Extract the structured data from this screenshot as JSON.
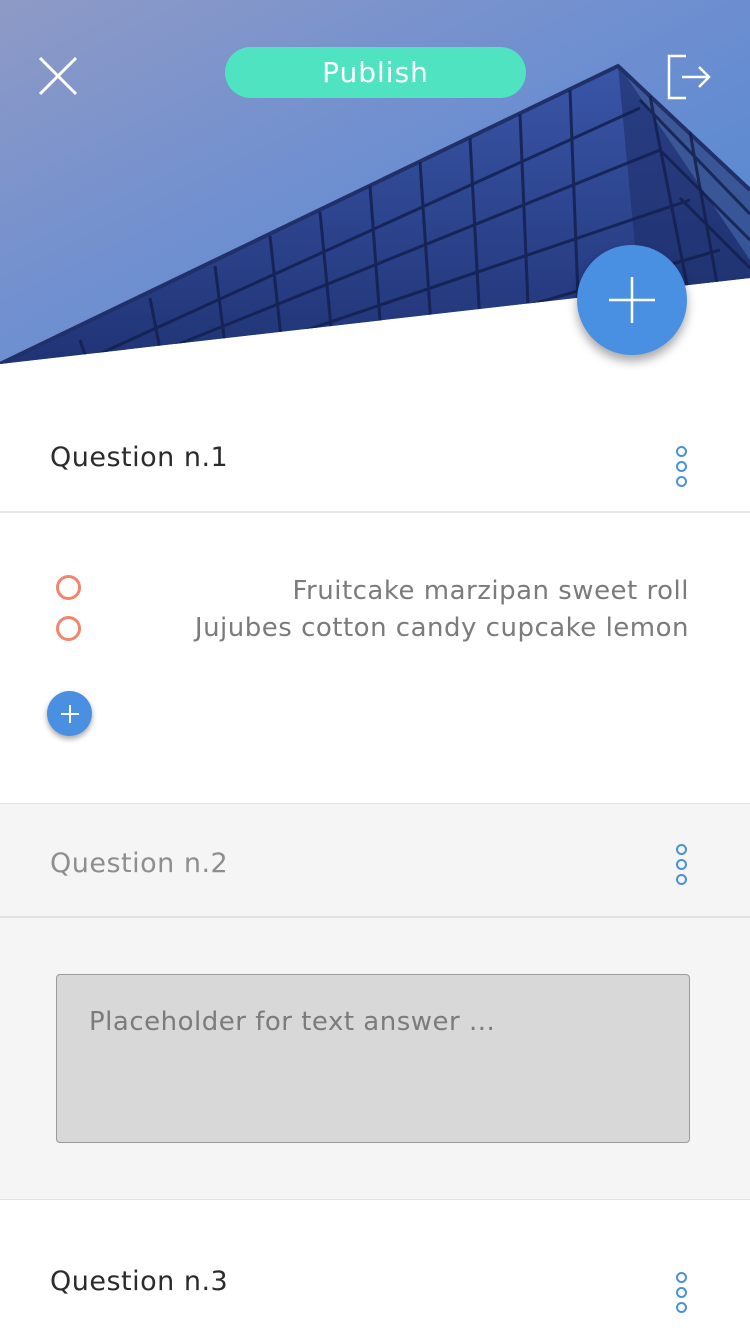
{
  "header": {
    "publish_label": "Publish",
    "close_icon": "close-icon",
    "exit_icon": "exit-icon",
    "add_icon": "plus-icon"
  },
  "questions": [
    {
      "title": "Question n.1",
      "options": [
        "Fruitcake marzipan sweet roll",
        "Jujubes cotton candy cupcake lemon"
      ]
    },
    {
      "title": "Question n.2",
      "answer_placeholder": "Placeholder for text answer ..."
    },
    {
      "title": "Question n.3"
    }
  ],
  "colors": {
    "accent_blue": "#4a90e2",
    "publish_green": "#50e3c2",
    "radio_orange": "#f0866a",
    "section_gray": "#f5f5f5",
    "answer_box_gray": "#d8d8d8"
  }
}
